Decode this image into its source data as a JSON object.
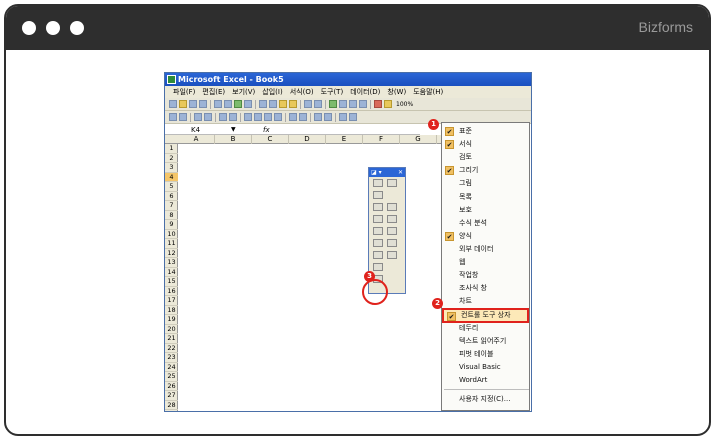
{
  "brand": "Bizforms",
  "window": {
    "title": "Microsoft Excel - Book5"
  },
  "menu": [
    "파일(F)",
    "편집(E)",
    "보기(V)",
    "삽입(I)",
    "서식(O)",
    "도구(T)",
    "데이터(D)",
    "창(W)",
    "도움말(H)"
  ],
  "toolbar": {
    "zoom": "100%"
  },
  "formula_bar": {
    "name_box": "K4",
    "fx": "fx"
  },
  "columns": [
    "A",
    "B",
    "C",
    "D",
    "E",
    "F",
    "G"
  ],
  "rows": [
    "1",
    "2",
    "3",
    "4",
    "5",
    "6",
    "7",
    "8",
    "9",
    "10",
    "11",
    "12",
    "13",
    "14",
    "15",
    "16",
    "17",
    "18",
    "19",
    "20",
    "21",
    "22",
    "23",
    "24",
    "25",
    "26",
    "27",
    "28"
  ],
  "selected_row": "4",
  "context_menu": {
    "items": [
      {
        "label": "표준",
        "checked": true
      },
      {
        "label": "서식",
        "checked": true
      },
      {
        "label": "검토",
        "checked": false
      },
      {
        "label": "그리기",
        "checked": true
      },
      {
        "label": "그림",
        "checked": false
      },
      {
        "label": "목록",
        "checked": false
      },
      {
        "label": "보호",
        "checked": false
      },
      {
        "label": "수식 분석",
        "checked": false
      },
      {
        "label": "양식",
        "checked": true
      },
      {
        "label": "외부 데이터",
        "checked": false
      },
      {
        "label": "웹",
        "checked": false
      },
      {
        "label": "작업창",
        "checked": false
      },
      {
        "label": "조사식 창",
        "checked": false
      },
      {
        "label": "차트",
        "checked": false
      },
      {
        "label": "컨트롤 도구 상자",
        "checked": true,
        "highlight": true
      },
      {
        "label": "테두리",
        "checked": false
      },
      {
        "label": "텍스트 읽어주기",
        "checked": false
      },
      {
        "label": "피벗 테이블",
        "checked": false
      },
      {
        "label": "Visual Basic",
        "checked": false
      },
      {
        "label": "WordArt",
        "checked": false
      }
    ],
    "customize": "사용자 지정(C)..."
  },
  "badges": [
    "1",
    "2",
    "3"
  ],
  "colors": {
    "frame": "#2e2e2e",
    "accent": "#e0221c",
    "title_blue": "#2b66d6"
  }
}
